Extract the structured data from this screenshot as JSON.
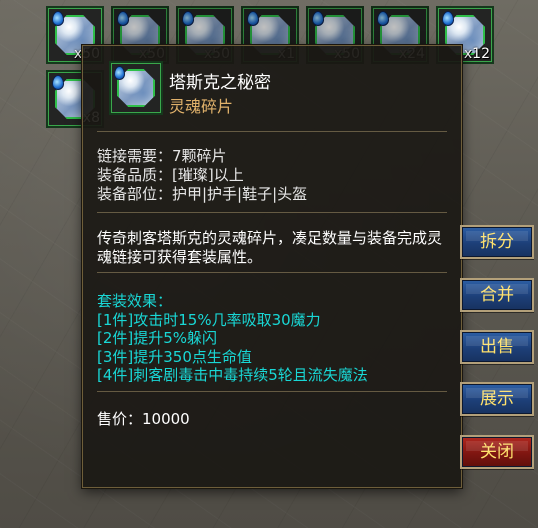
{
  "inventory": {
    "slots": [
      {
        "count": "x50"
      },
      {
        "count": "x50"
      },
      {
        "count": "x50"
      },
      {
        "count": "x1"
      },
      {
        "count": "x50"
      },
      {
        "count": "x24"
      },
      {
        "count": "x12"
      },
      {
        "count": "x8"
      }
    ]
  },
  "tooltip": {
    "title": "塔斯克之秘密",
    "subtitle": "灵魂碎片",
    "requirements": [
      "链接需要：7颗碎片",
      "装备品质：[璀璨]以上",
      "装备部位：护甲|护手|鞋子|头盔"
    ],
    "description": "传奇刺客塔斯克的灵魂碎片，凑足数量与装备完成灵魂链接可获得套装属性。",
    "set_effects": {
      "heading": "套装效果：",
      "items": [
        "[1件]攻击时15%几率吸取30魔力",
        "[2件]提升5%躲闪",
        "[3件]提升350点生命值",
        "[4件]刺客剧毒击中毒持续5轮且流失魔法"
      ]
    },
    "price": "售价：10000"
  },
  "actions": {
    "split": "拆分",
    "merge": "合并",
    "sell": "出售",
    "show": "展示",
    "close": "关闭"
  },
  "colors": {
    "title": "#ffffff",
    "subtitle": "#e1b26b",
    "set_effect": "#19d7d5",
    "button_text": "#ffe16b",
    "button_blue": "#1d3f78",
    "button_red": "#7f1611"
  },
  "icons": {
    "item": "soul-shard-icon",
    "badge": "water-drop-icon"
  }
}
